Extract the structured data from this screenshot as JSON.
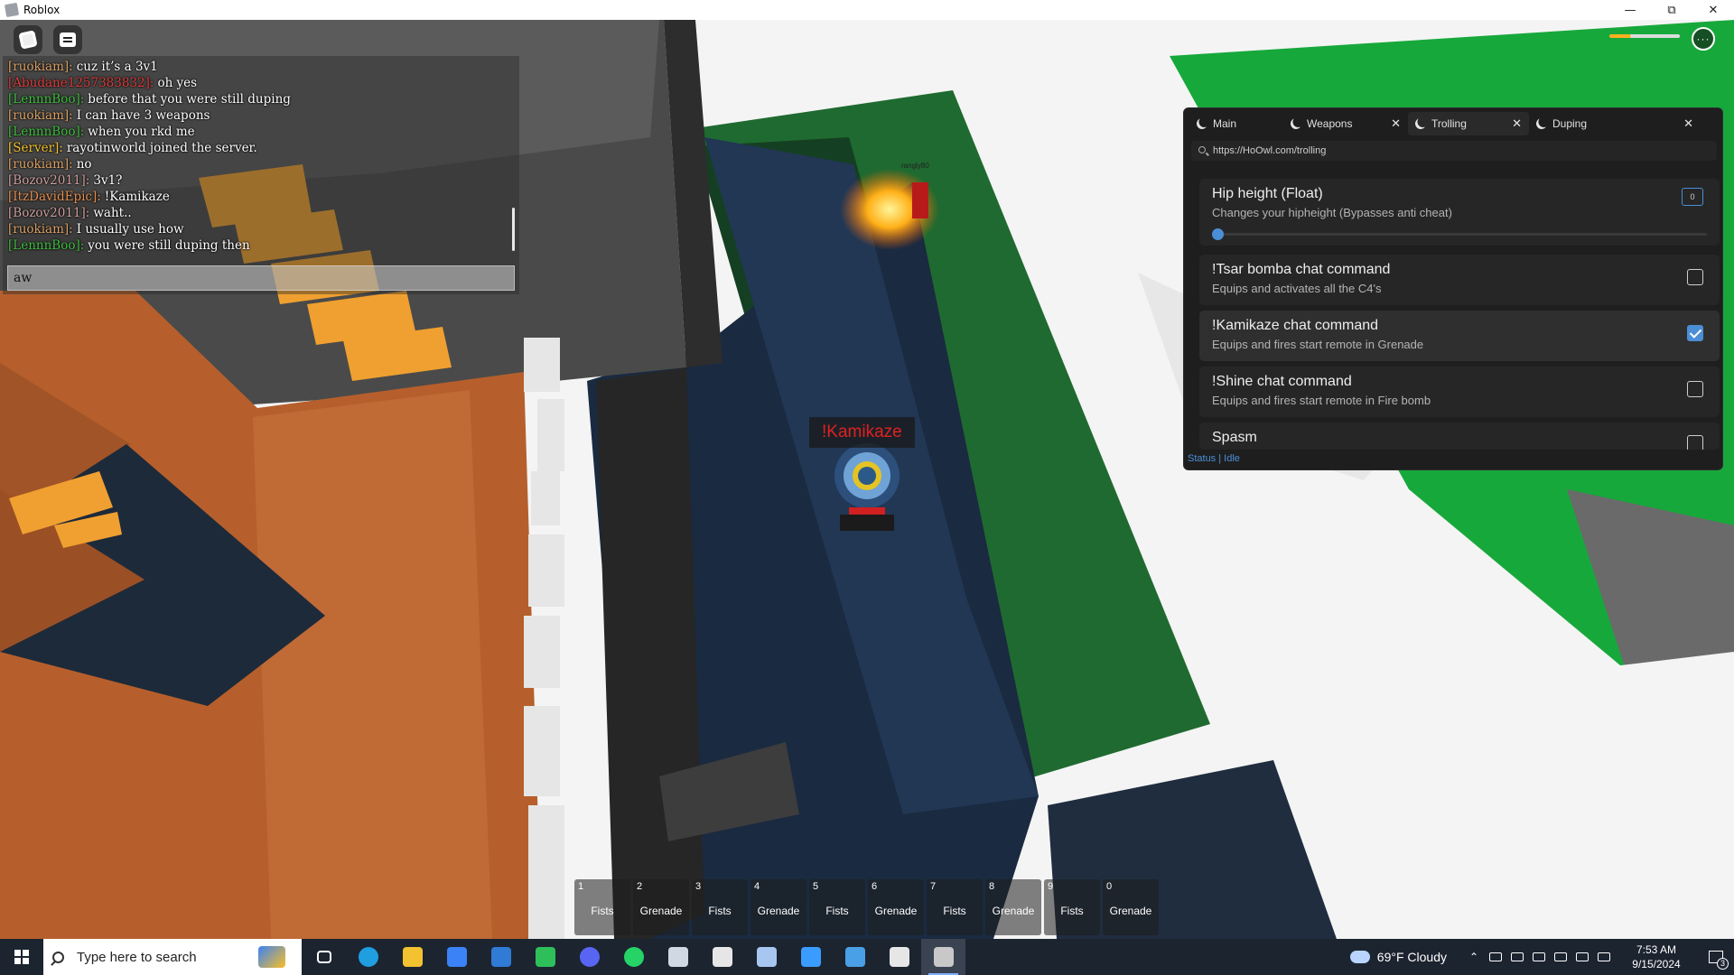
{
  "window": {
    "title": "Roblox"
  },
  "chat": {
    "messages": [
      {
        "user": "[ruokiam]:",
        "text": "cuz it’s a 3v1",
        "color": "#d9a066"
      },
      {
        "user": "[Abudane1257383832]:",
        "text": "oh yes",
        "color": "#e03b3b"
      },
      {
        "user": "[LennnBoo]:",
        "text": "before that you were still duping",
        "color": "#3fbf3f"
      },
      {
        "user": "[ruokiam]:",
        "text": "I can have 3 weapons",
        "color": "#d9a066"
      },
      {
        "user": "[LennnBoo]:",
        "text": "when you rkd me",
        "color": "#3fbf3f"
      },
      {
        "user": "[Server]:",
        "text": "rayotinworld joined the server.",
        "color": "#f2c230"
      },
      {
        "user": "[ruokiam]:",
        "text": "no",
        "color": "#d9a066"
      },
      {
        "user": "[Bozov2011]:",
        "text": "3v1?",
        "color": "#d0a0a0"
      },
      {
        "user": "[ItzDavidEpic]:",
        "text": "!Kamikaze",
        "color": "#e58f4f"
      },
      {
        "user": "[Bozov2011]:",
        "text": "waht..",
        "color": "#d0a0a0"
      },
      {
        "user": "[ruokiam]:",
        "text": "I usually use how",
        "color": "#d9a066"
      },
      {
        "user": "[LennnBoo]:",
        "text": "you were still duping then",
        "color": "#3fbf3f"
      }
    ],
    "input_value": "aw"
  },
  "scene": {
    "kamikaze_tag": "!Kamikaze",
    "player_tag": "rangly80"
  },
  "panel": {
    "tabs": [
      {
        "label": "Main",
        "active": false
      },
      {
        "label": "Weapons",
        "active": false
      },
      {
        "label": "Trolling",
        "active": true
      },
      {
        "label": "Duping",
        "active": false
      }
    ],
    "url": "https://HoOwl.com/trolling",
    "options": [
      {
        "title": "Hip height (Float)",
        "desc": "Changes your hipheight (Bypasses anti cheat)",
        "value": "0",
        "slider_fraction": 0
      },
      {
        "title": "!Tsar bomba chat command",
        "desc": "Equips and activates all the C4's",
        "checked": false
      },
      {
        "title": "!Kamikaze chat command",
        "desc": "Equips and fires start remote in Grenade",
        "checked": true
      },
      {
        "title": "!Shine chat command",
        "desc": "Equips and fires start remote in Fire bomb",
        "checked": false
      },
      {
        "title": "Spasm",
        "desc": "",
        "checked": false
      }
    ],
    "status": "Status | Idle",
    "accent": "#4a8fd6"
  },
  "hotbar": [
    {
      "num": "1",
      "name": "Fists"
    },
    {
      "num": "2",
      "name": "Grenade"
    },
    {
      "num": "3",
      "name": "Fists"
    },
    {
      "num": "4",
      "name": "Grenade"
    },
    {
      "num": "5",
      "name": "Fists"
    },
    {
      "num": "6",
      "name": "Grenade"
    },
    {
      "num": "7",
      "name": "Fists"
    },
    {
      "num": "8",
      "name": "Grenade"
    },
    {
      "num": "9",
      "name": "Fists"
    },
    {
      "num": "0",
      "name": "Grenade"
    }
  ],
  "taskbar": {
    "search_placeholder": "Type here to search",
    "apps": [
      "task-view-icon",
      "edge-icon",
      "file-explorer-icon",
      "store-icon",
      "mail-icon",
      "h-app-icon",
      "discord-icon",
      "whatsapp-icon",
      "app-icon",
      "shield-app-icon",
      "notepad-icon",
      "snipping-icon",
      "window-app-icon",
      "star-app-icon",
      "roblox-icon"
    ],
    "weather": "69°F  Cloudy",
    "time": "7:53 AM",
    "date": "9/15/2024",
    "notifications": "3"
  }
}
